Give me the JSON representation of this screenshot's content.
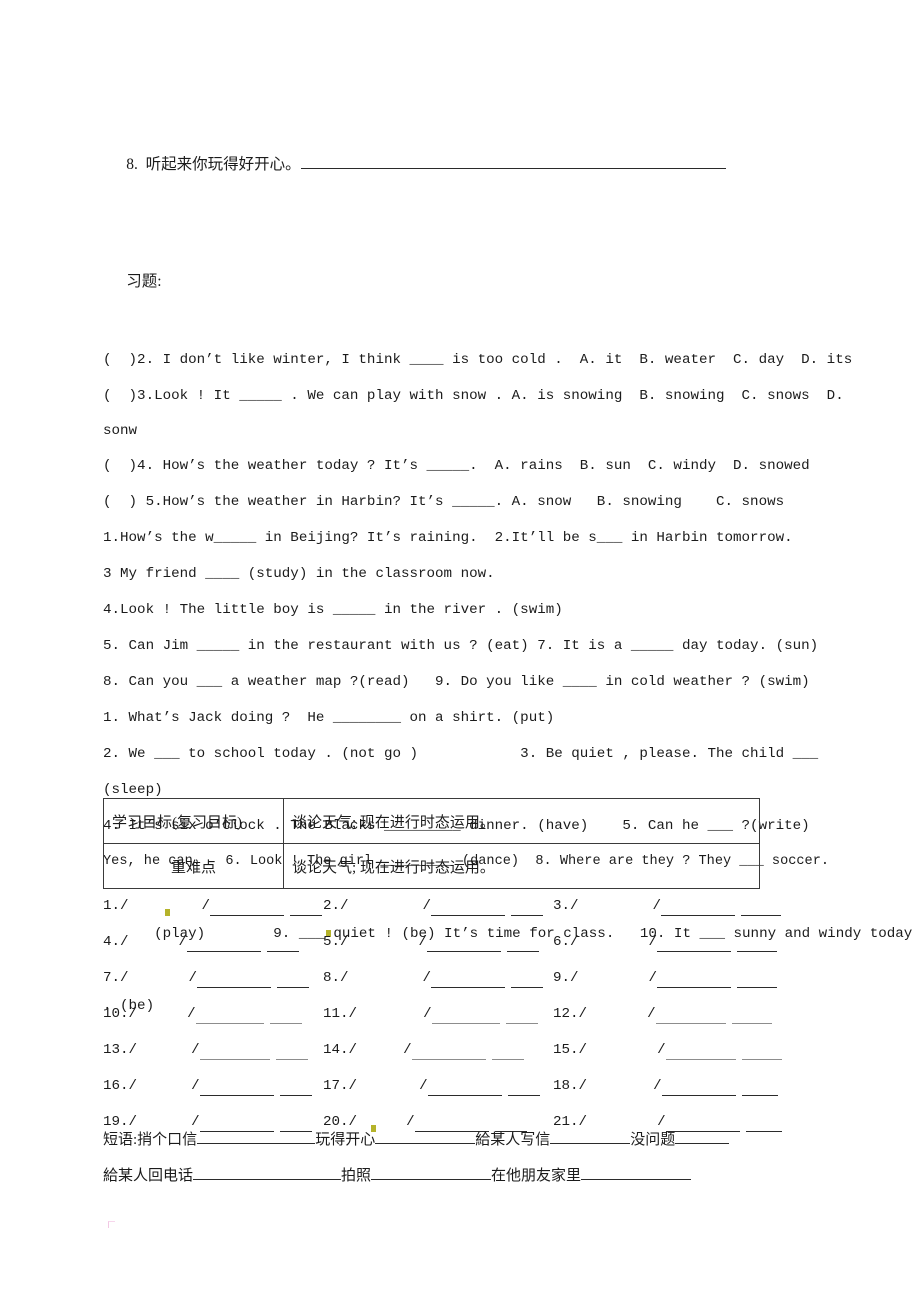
{
  "document": {
    "type": "chinese-english-worksheet",
    "page_background": "#ffffff",
    "text_color": "#1b1b1b",
    "mark_color": "#b5b32a"
  },
  "lines": {
    "l1_num": "8.  听起来你玩得好开心。",
    "l2": "习题:",
    "q2": "(  )2. I don’t like winter, I think ____ is too cold .  A. it  B. weater  C. day  D. its",
    "q3a": "(  )3.Look ! It _____ . We can play with snow . A. is snowing  B. snowing  C. snows  D.",
    "q3b": "sonw",
    "q4": "(  )4. How’s the weather today ? It’s _____.  A. rains  B. sun  C. windy  D. snowed",
    "q5": "(  ) 5.How’s the weather in Harbin? It’s _____. A. snow   B. snowing    C. snows",
    "f1": "1.How’s the w_____ in Beijing? It’s raining.  2.It’ll be s___ in Harbin tomorrow.",
    "f3": "3 My friend ____ (study) in the classroom now.",
    "f4": "4.Look ! The little boy is _____ in the river . (swim)",
    "f5": "5. Can Jim _____ in the restaurant with us ? (eat) 7. It is a _____ day today. (sun)",
    "f8": "8. Can you ___ a weather map ?(read)   9. Do you like ____ in cold weather ? (swim)",
    "g1": "1. What’s Jack doing ?  He ________ on a shirt. (put)",
    "g2": "2. We ___ to school today . (not go )            3. Be quiet , please. The child ___",
    "g2b": "(sleep)",
    "g4": "4. It’s six o’clock . The Blacks _________ dinner. (have)    5. Can he ___ ?(write)",
    "g6": "Yes, he can.   6. Look ! The girl _________ (dance)  8. Where are they ? They ___ soccer.",
    "g9a": "(play)        9. ___",
    "g9b": "quiet ! (be) It’s time for class.   10. It ___ sunny and windy today",
    "g10": ". (be)"
  },
  "table": {
    "rows": [
      {
        "label": "学习目标(复习目标)",
        "value": "谈论天气; 现在进行时态运用。"
      },
      {
        "label": "重难点",
        "value": "谈论天气; 现在进行时态运用。"
      }
    ]
  },
  "grid": {
    "items": [
      "1.",
      "2.",
      "3.",
      "4.",
      "5.",
      "6.",
      "7.",
      "8.",
      "9.",
      "10.",
      "11.",
      "12.",
      "13.",
      "14.",
      "15.",
      "16.",
      "17.",
      "18.",
      "19.",
      "20.",
      "21."
    ],
    "slash": "/"
  },
  "phrases": {
    "line1_label": "短语:",
    "line1": [
      {
        "text": "捎个口信",
        "blank": 118
      },
      {
        "text": "玩得开心",
        "blank": 100
      },
      {
        "text": "給某人写信",
        "blank": 80
      },
      {
        "text": "没问题",
        "blank": 54
      }
    ],
    "line2": [
      {
        "text": "給某人回电话",
        "blank": 148
      },
      {
        "text": "拍照",
        "blank": 120
      },
      {
        "text": "在他朋友家里",
        "blank": 110
      }
    ]
  }
}
